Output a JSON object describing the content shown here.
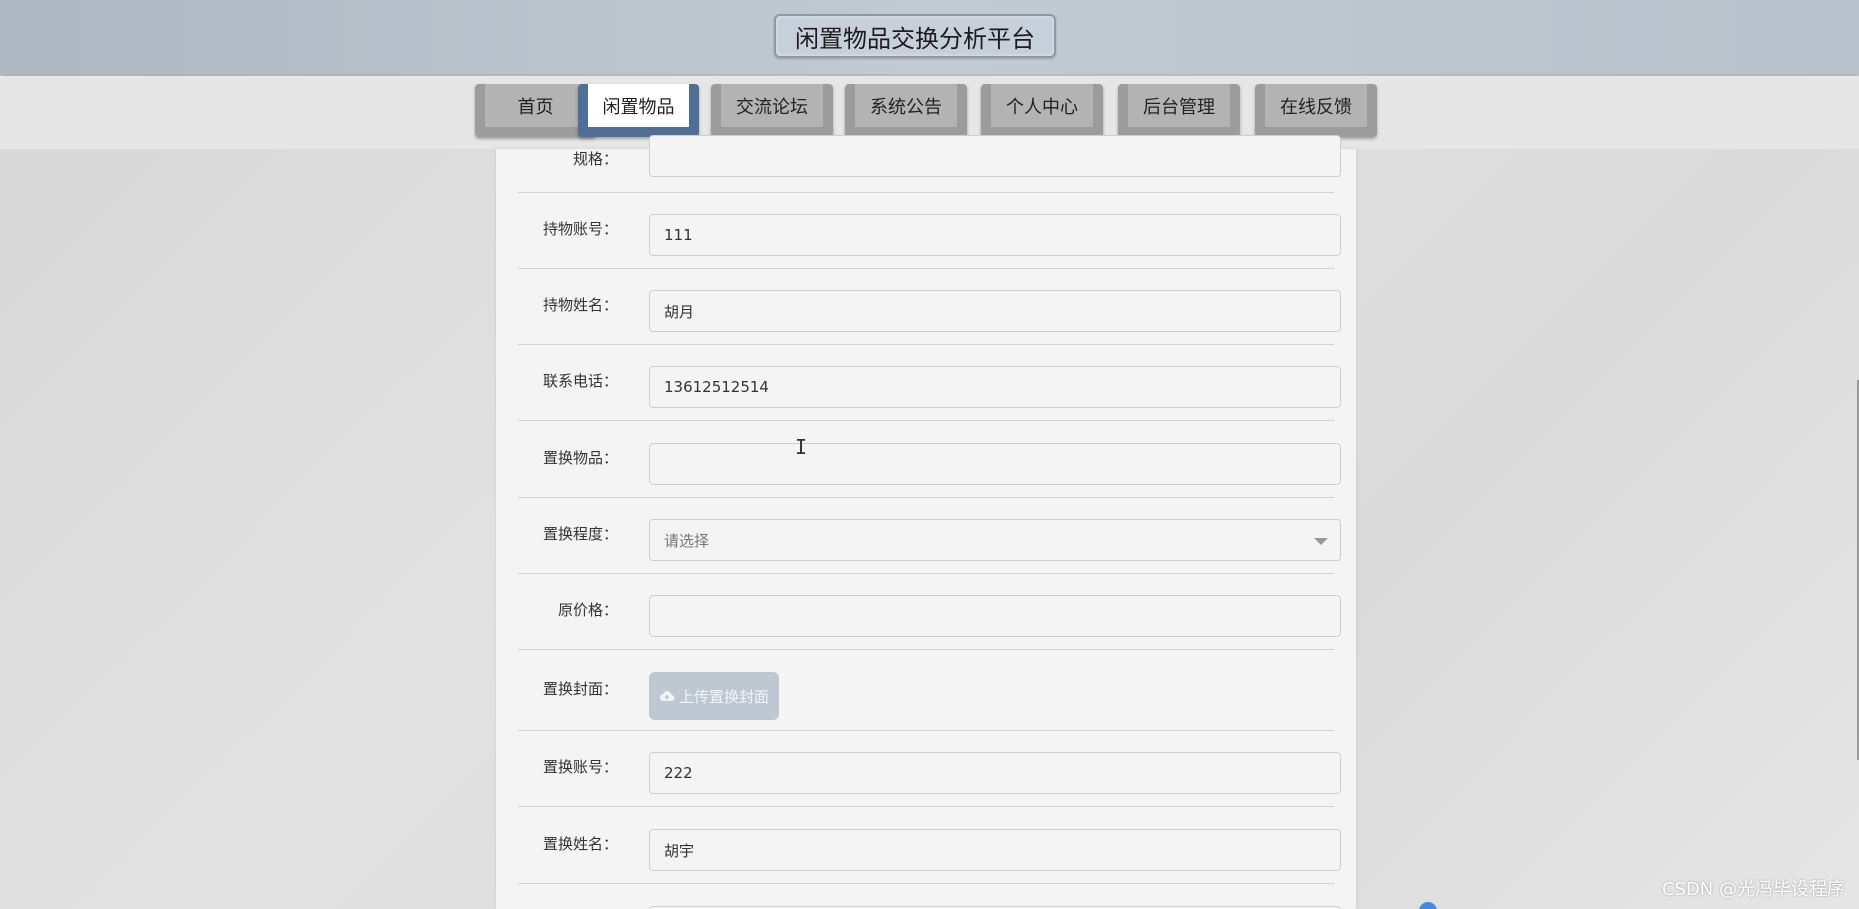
{
  "header": {
    "title": "闲置物品交换分析平台"
  },
  "nav": {
    "items": [
      {
        "label": "首页"
      },
      {
        "label": "闲置物品"
      },
      {
        "label": "交流论坛"
      },
      {
        "label": "系统公告"
      },
      {
        "label": "个人中心"
      },
      {
        "label": "后台管理"
      },
      {
        "label": "在线反馈"
      }
    ],
    "active": "闲置物品",
    "active_color": "#4f6f96"
  },
  "form": {
    "spec": {
      "label": "规格：",
      "value": ""
    },
    "owner_account": {
      "label": "持物账号：",
      "value": "111"
    },
    "owner_name": {
      "label": "持物姓名：",
      "value": "胡月"
    },
    "phone": {
      "label": "联系电话：",
      "value": "13612512514"
    },
    "exchange_item": {
      "label": "置换物品：",
      "value": ""
    },
    "exchange_degree": {
      "label": "置换程度：",
      "placeholder": "请选择"
    },
    "original_price": {
      "label": "原价格：",
      "value": ""
    },
    "exchange_cover": {
      "label": "置换封面：",
      "button_label": "上传置换封面",
      "icon": "cloud-upload-icon"
    },
    "exchange_account": {
      "label": "置换账号：",
      "value": "222"
    },
    "exchange_name": {
      "label": "置换姓名：",
      "value": "胡宇"
    }
  },
  "watermark": "CSDN @光冯毕设程序"
}
